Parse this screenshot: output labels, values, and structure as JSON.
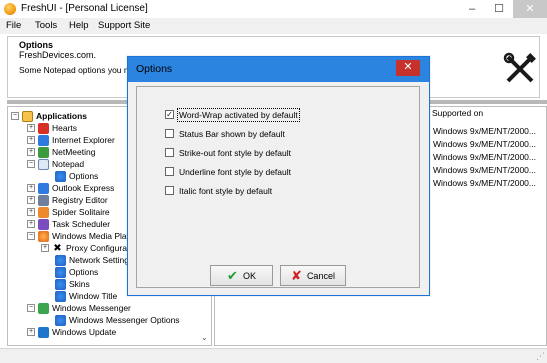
{
  "window": {
    "title": "FreshUI - [Personal License]",
    "controls": {
      "minimize": "–",
      "maximize": "☐",
      "close": "✕"
    }
  },
  "menu": [
    "File",
    "Tools",
    "Help",
    "Support Site"
  ],
  "info": {
    "title": "Options",
    "company": "FreshDevices.com.",
    "description": "Some Notepad options you mi"
  },
  "tree": [
    {
      "label": "Applications",
      "expander": "−",
      "icon": "applications-icon",
      "bold": true
    },
    {
      "label": "Hearts",
      "expander": "+",
      "icon": "hearts-icon"
    },
    {
      "label": "Internet Explorer",
      "expander": "+",
      "icon": "internet-explorer-icon"
    },
    {
      "label": "NetMeeting",
      "expander": "+",
      "icon": "netmeeting-icon"
    },
    {
      "label": "Notepad",
      "expander": "−",
      "icon": "notepad-icon"
    },
    {
      "label": "Options",
      "expander": "",
      "icon": "options-icon"
    },
    {
      "label": "Outlook Express",
      "expander": "+",
      "icon": "outlook-express-icon"
    },
    {
      "label": "Registry Editor",
      "expander": "+",
      "icon": "registry-editor-icon"
    },
    {
      "label": "Spider Solitaire",
      "expander": "+",
      "icon": "spider-solitaire-icon"
    },
    {
      "label": "Task Scheduler",
      "expander": "+",
      "icon": "task-scheduler-icon"
    },
    {
      "label": "Windows Media Play",
      "expander": "−",
      "icon": "windows-media-player-icon"
    },
    {
      "label": "Proxy Configura",
      "expander": "+",
      "icon": "proxy-icon"
    },
    {
      "label": "Network Setting",
      "expander": "",
      "icon": "network-settings-icon"
    },
    {
      "label": "Options",
      "expander": "",
      "icon": "options-icon"
    },
    {
      "label": "Skins",
      "expander": "",
      "icon": "skins-icon"
    },
    {
      "label": "Window Title",
      "expander": "",
      "icon": "window-title-icon"
    },
    {
      "label": "Windows Messenger",
      "expander": "−",
      "icon": "windows-messenger-icon"
    },
    {
      "label": "Windows Messenger Options",
      "expander": "",
      "icon": "messenger-options-icon"
    },
    {
      "label": "Windows Update",
      "expander": "+",
      "icon": "windows-update-icon"
    }
  ],
  "list": {
    "column_header": "Supported on",
    "rows": [
      "Windows 9x/ME/NT/2000...",
      "Windows 9x/ME/NT/2000...",
      "Windows 9x/ME/NT/2000...",
      "Windows 9x/ME/NT/2000...",
      "Windows 9x/ME/NT/2000..."
    ]
  },
  "dialog": {
    "title": "Options",
    "close": "✕",
    "options": [
      {
        "label": "Word-Wrap activated by default",
        "checked": true
      },
      {
        "label": "Status Bar shown by default",
        "checked": false
      },
      {
        "label": "Strike-out font style by default",
        "checked": false
      },
      {
        "label": "Underline font style by default",
        "checked": false
      },
      {
        "label": "Italic font style by default",
        "checked": false
      }
    ],
    "ok_label": "OK",
    "cancel_label": "Cancel"
  },
  "colors": {
    "dialog_titlebar": "#2b84e0",
    "close_button": "#c7312b",
    "ok_icon": "#1f9c2f",
    "cancel_icon": "#cf1f1f"
  }
}
